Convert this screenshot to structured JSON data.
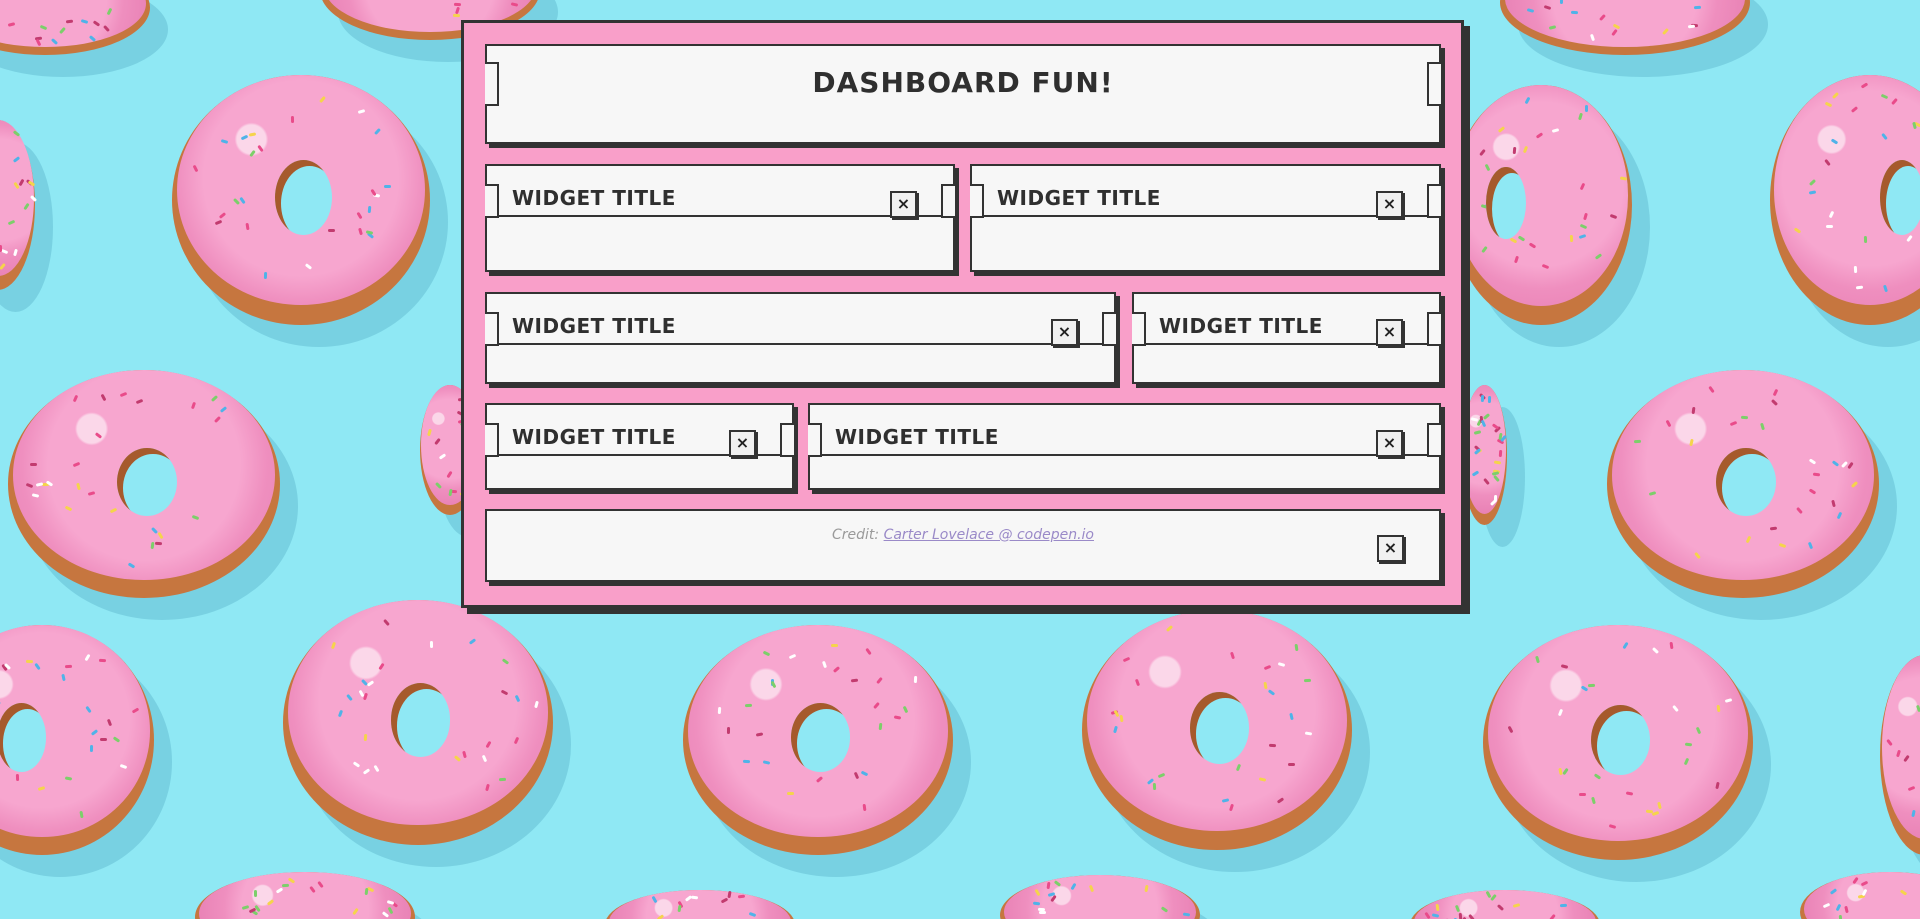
{
  "header": {
    "title": "DASHBOARD FUN!"
  },
  "widgets": [
    {
      "title": "WIDGET TITLE",
      "close": "×"
    },
    {
      "title": "WIDGET TITLE",
      "close": "×"
    },
    {
      "title": "WIDGET TITLE",
      "close": "×"
    },
    {
      "title": "WIDGET TITLE",
      "close": "×"
    },
    {
      "title": "WIDGET TITLE",
      "close": "×"
    },
    {
      "title": "WIDGET TITLE",
      "close": "×"
    }
  ],
  "footer": {
    "credit_prefix": "Credit: ",
    "credit_link": "Carter Lovelace @ codepen.io",
    "close": "×"
  },
  "colors": {
    "background": "#8fe8f4",
    "dashboard": "#f99fc9",
    "panel": "#f7f7f7",
    "border": "#333333",
    "icing": "#f7a6cf",
    "dough": "#c6763f"
  }
}
